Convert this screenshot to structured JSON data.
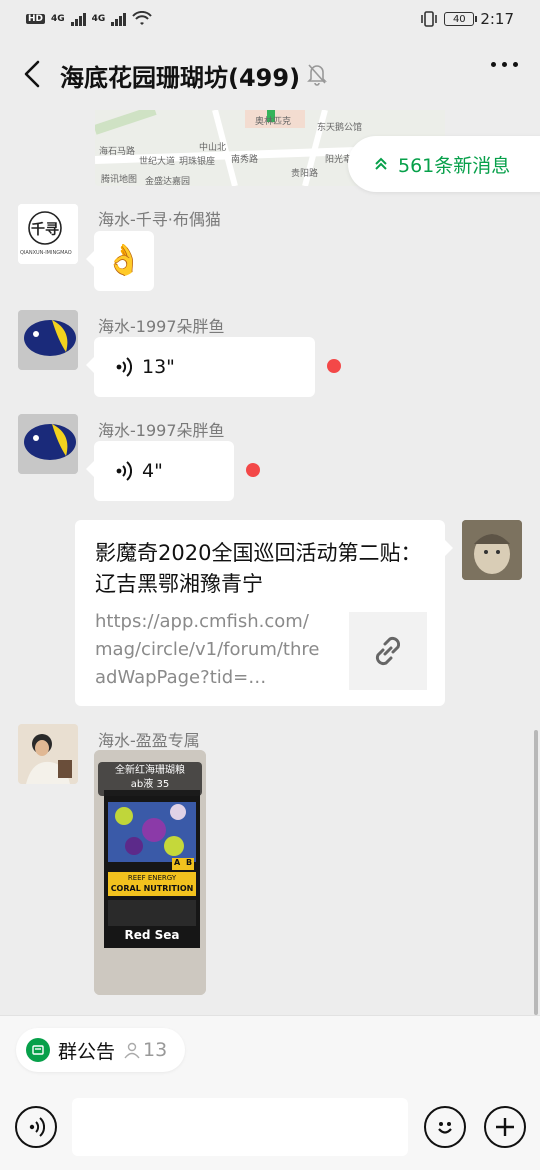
{
  "status_bar": {
    "hd_label": "HD",
    "net_1": "4G",
    "net_2": "4G",
    "battery": "40",
    "time": "2:17"
  },
  "header": {
    "title": "海底花园珊瑚坊(499)"
  },
  "map": {
    "labels": [
      "海石马路",
      "腾讯地图",
      "世纪大道",
      "玥珠银座",
      "中山北",
      "南秀路",
      "奥林匹克",
      "东天鹅公馆",
      "贵阳路",
      "阳光幸福",
      "金盛达嘉园"
    ]
  },
  "new_messages": {
    "label": "561条新消息"
  },
  "messages": [
    {
      "sender": "海水-千寻·布偶猫",
      "type": "emoji",
      "emoji": "👌"
    },
    {
      "sender": "海水-1997朵胖鱼",
      "type": "voice",
      "duration": "13\""
    },
    {
      "sender": "海水-1997朵胖鱼",
      "type": "voice",
      "duration": "4\""
    },
    {
      "sender": "self",
      "type": "link",
      "title": "影魔奇2020全国巡回活动第二贴： 辽吉黑鄂湘豫青宁",
      "url": "https://app.cmfish.com/mag/circle/v1/forum/threadWapPage?tid=…"
    },
    {
      "sender": "海水-盈盈专属",
      "type": "image",
      "caption_line1": "全新红海珊瑚粮",
      "caption_line2": "ab液 35",
      "product_text": [
        "REEF ENERGY",
        "CORAL NUTRITION",
        "A",
        "B",
        "Red Sea"
      ]
    }
  ],
  "avatar_text": {
    "qianxun": "千寻",
    "qianxun_sub": "QIANXUN-IMINGMAO"
  },
  "notice": {
    "label": "群公告",
    "count": "13"
  },
  "colors": {
    "accent_green": "#07a04a",
    "unread_red": "#f34848",
    "background": "#ededed"
  }
}
